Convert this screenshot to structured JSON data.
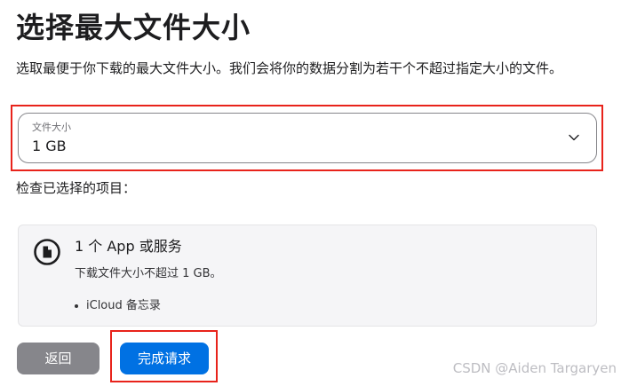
{
  "page": {
    "title": "选择最大文件大小",
    "description": "选取最便于你下载的最大文件大小。我们会将你的数据分割为若干个不超过指定大小的文件。"
  },
  "file_size_select": {
    "label": "文件大小",
    "value": "1 GB",
    "icon": "chevron-down-icon"
  },
  "selected_items": {
    "heading": "检查已选择的项目：",
    "card": {
      "icon": "document-icon",
      "title": "1 个 App 或服务",
      "subtitle": "下载文件大小不超过 1 GB。",
      "items": [
        "iCloud 备忘录"
      ]
    }
  },
  "actions": {
    "back_label": "返回",
    "done_label": "完成请求"
  },
  "watermark": "CSDN @Aiden Targaryen",
  "colors": {
    "primary_button": "#0071e3",
    "secondary_button": "#86868b",
    "highlight_border": "#e8231b"
  }
}
